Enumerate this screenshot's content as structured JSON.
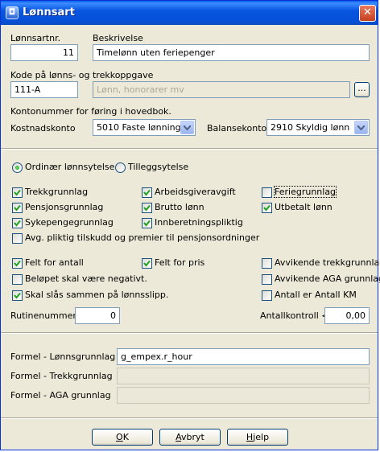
{
  "window": {
    "title": "Lønnsart"
  },
  "header": {
    "lonnsartnr_label": "Lønnsartnr.",
    "lonnsartnr_value": "11",
    "beskrivelse_label": "Beskrivelse",
    "beskrivelse_value": "Timelønn uten feriepenger",
    "kode_label": "Kode på lønns- og trekkoppgave",
    "kode_value": "111-A",
    "kode_desc_value": "Lønn, honorarer mv",
    "browse_label": "...",
    "konto_label": "Kontonummer for føring i hovedbok.",
    "kostnad_label": "Kostnadskonto",
    "kostnad_value": "5010 Faste lønninger",
    "balanse_label": "Balansekonto",
    "balanse_value": "2910 Skyldig lønn"
  },
  "type": {
    "ordinaer_label": "Ordinær lønnsytelse",
    "ordinaer_selected": true,
    "tillegg_label": "Tilleggsytelse",
    "tillegg_selected": false
  },
  "checks": {
    "trekkgrunnlag": "Trekkgrunnlag",
    "arbeidsgiveravgift": "Arbeidsgiveravgift",
    "feriegrunnlag": "Feriegrunnlag",
    "pensjonsgrunnlag": "Pensjonsgrunnlag",
    "brutto_lonn": "Brutto lønn",
    "utbetalt_lonn": "Utbetalt lønn",
    "sykepengegrunnlag": "Sykepengegrunnlag",
    "innberetningspliktig": "Innberetningspliktig",
    "avg_pliktig": "Avg. pliktig tilskudd og premier til pensjonsordninger",
    "felt_antall": "Felt for antall",
    "felt_pris": "Felt for pris",
    "avvikende_trekk": "Avvikende trekkgrunnlag",
    "belop_negativt": "Beløpet skal være negativt.",
    "avvikende_aga": "Avvikende AGA grunnlag",
    "slas_sammen": "Skal slås sammen på lønnsslipp.",
    "antall_km": "Antall er Antall KM"
  },
  "check_states": {
    "trekkgrunnlag": true,
    "arbeidsgiveravgift": true,
    "feriegrunnlag": false,
    "pensjonsgrunnlag": true,
    "brutto_lonn": true,
    "utbetalt_lonn": true,
    "sykepengegrunnlag": true,
    "innberetningspliktig": true,
    "avg_pliktig": false,
    "felt_antall": true,
    "felt_pris": true,
    "avvikende_trekk": false,
    "belop_negativt": false,
    "avvikende_aga": false,
    "slas_sammen": true,
    "antall_km": false
  },
  "rutine": {
    "label": "Rutinenummer",
    "value": "0"
  },
  "antallkontroll": {
    "label": "Antallkontroll <",
    "value": "0,00"
  },
  "formel": {
    "lonn_label": "Formel - Lønnsgrunnlag",
    "lonn_value": "g_empex.r_hour",
    "trekk_label": "Formel - Trekkgrunnlag",
    "trekk_value": "",
    "aga_label": "Formel - AGA grunnlag",
    "aga_value": ""
  },
  "buttons": {
    "ok_mnemonic": "O",
    "ok_rest": "K",
    "avbryt_mnemonic": "A",
    "avbryt_rest": "vbryt",
    "hjelp_mnemonic": "H",
    "hjelp_rest": "jelp"
  },
  "colors": {
    "titlebar": "#0550d8",
    "dialog_bg": "#ece9d8",
    "input_border": "#7f9db9",
    "check_green": "#21a121"
  }
}
